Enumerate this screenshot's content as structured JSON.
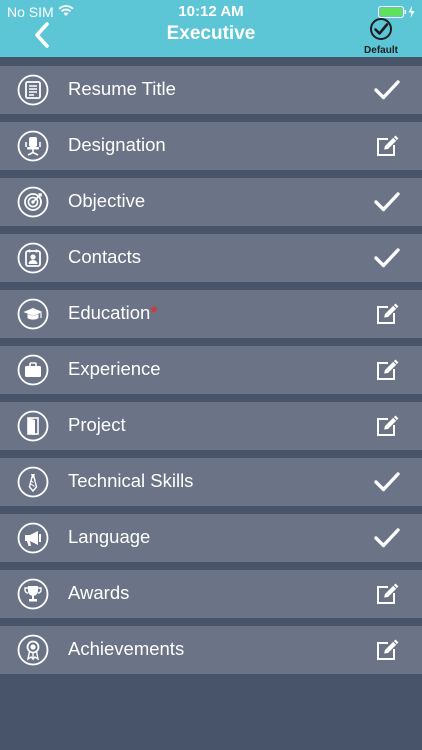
{
  "statusbar": {
    "carrier": "No SIM",
    "time": "10:12 AM"
  },
  "header": {
    "title": "Executive",
    "default_label": "Default"
  },
  "sections": [
    {
      "label": "Resume Title",
      "icon": "document-icon",
      "status": "done",
      "required": false
    },
    {
      "label": "Designation",
      "icon": "office-chair-icon",
      "status": "edit",
      "required": false
    },
    {
      "label": "Objective",
      "icon": "target-icon",
      "status": "done",
      "required": false
    },
    {
      "label": "Contacts",
      "icon": "contact-card-icon",
      "status": "done",
      "required": false
    },
    {
      "label": "Education",
      "icon": "graduation-cap-icon",
      "status": "edit",
      "required": true
    },
    {
      "label": "Experience",
      "icon": "briefcase-icon",
      "status": "edit",
      "required": false
    },
    {
      "label": "Project",
      "icon": "door-icon",
      "status": "edit",
      "required": false
    },
    {
      "label": "Technical Skills",
      "icon": "tie-icon",
      "status": "done",
      "required": false
    },
    {
      "label": "Language",
      "icon": "megaphone-icon",
      "status": "done",
      "required": false
    },
    {
      "label": "Awards",
      "icon": "trophy-icon",
      "status": "edit",
      "required": false
    },
    {
      "label": "Achievements",
      "icon": "ribbon-icon",
      "status": "edit",
      "required": false
    }
  ],
  "required_marker": "*",
  "colors": {
    "header": "#5cc6d6",
    "row": "#6b7386",
    "background": "#485469",
    "required": "#ff1e1e"
  }
}
